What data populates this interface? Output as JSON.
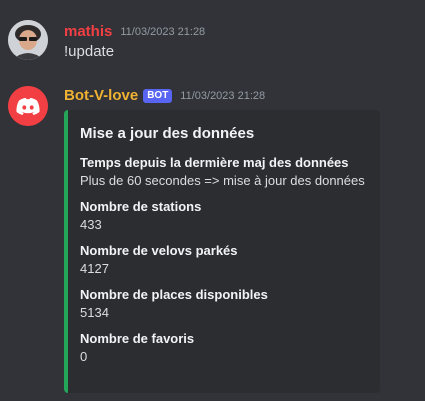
{
  "messages": [
    {
      "author": "mathis",
      "author_color": "#f23f43",
      "timestamp": "11/03/2023 21:28",
      "content": "!update",
      "avatar_icon": "user-avatar"
    },
    {
      "author": "Bot-V-love",
      "author_color": "#f0b232",
      "badge": "BOT",
      "timestamp": "11/03/2023 21:28",
      "avatar_icon": "discord-logo",
      "avatar_color": "#f23f43",
      "embed": {
        "accent_color": "#23a55a",
        "title": "Mise a jour des données",
        "fields": [
          {
            "name": "Temps depuis la dermière maj des données",
            "value": "Plus de 60 secondes => mise à jour des données"
          },
          {
            "name": "Nombre de stations",
            "value": "433"
          },
          {
            "name": "Nombre de velovs parkés",
            "value": "4127"
          },
          {
            "name": "Nombre de places disponibles",
            "value": "5134"
          },
          {
            "name": "Nombre de favoris",
            "value": "0"
          }
        ]
      }
    }
  ]
}
